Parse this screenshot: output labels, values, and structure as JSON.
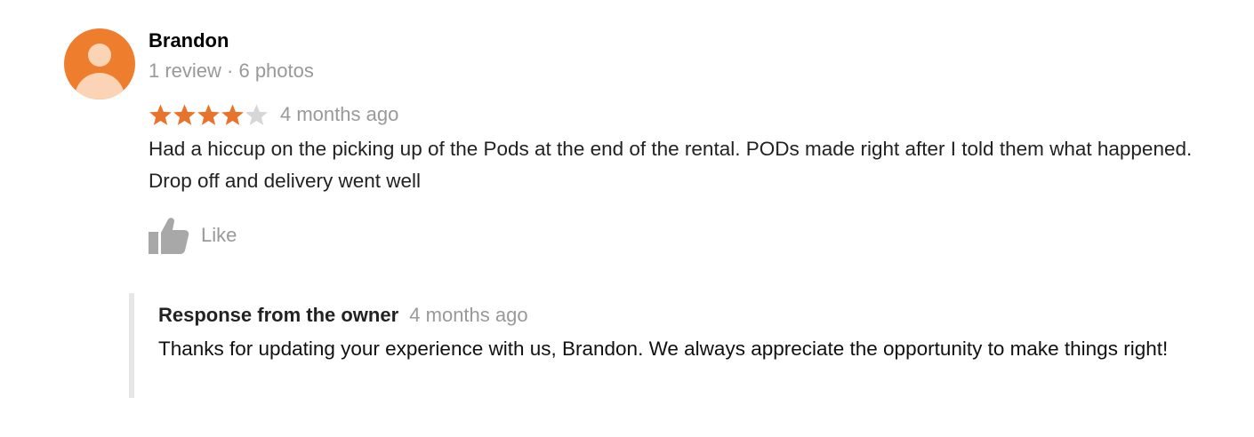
{
  "review": {
    "author": {
      "name": "Brandon",
      "meta": "1 review · 6 photos"
    },
    "rating": {
      "stars": 4,
      "max": 5,
      "filled_color": "#e8732c",
      "empty_color": "#d6d6d6"
    },
    "time": "4 months ago",
    "text": "Had a hiccup on the picking up of the Pods at the end of the rental. PODs made right after I told them what happened.  Drop off and delivery went well",
    "like_label": "Like",
    "like_icon": "thumbs-up-icon"
  },
  "owner_response": {
    "title": "Response from the owner",
    "time": "4 months ago",
    "text": "Thanks for updating your experience with us, Brandon. We always appreciate the opportunity to make things right!"
  },
  "colors": {
    "avatar_bg": "#ef7d2e",
    "avatar_fg": "#fbd3b5",
    "muted_text": "#999999",
    "response_border": "#e6e6e6"
  }
}
